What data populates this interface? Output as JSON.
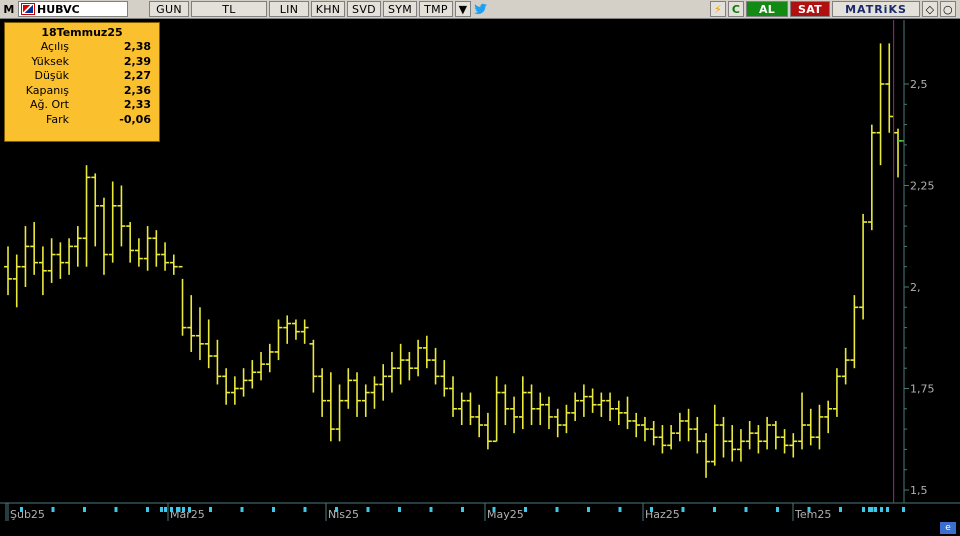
{
  "toolbar": {
    "menu_label": "M",
    "symbol": "HUBVC",
    "period": "GUN",
    "currency": "TL",
    "scale": "LIN",
    "b_khn": "KHN",
    "b_svd": "SVD",
    "b_sym": "SYM",
    "b_tmp": "TMP",
    "refresh": "C",
    "buy": "AL",
    "sell": "SAT",
    "brand": "MATRiKS"
  },
  "info": {
    "date": "18Temmuz25",
    "rows": [
      {
        "label": "Açılış",
        "value": "2,38"
      },
      {
        "label": "Yüksek",
        "value": "2,39"
      },
      {
        "label": "Düşük",
        "value": "2,27"
      },
      {
        "label": "Kapanış",
        "value": "2,36"
      },
      {
        "label": "Ağ. Ort",
        "value": "2,33"
      },
      {
        "label": "Fark",
        "value": "-0,06"
      }
    ]
  },
  "colors": {
    "background": "#000000",
    "bars": "#eaea3a",
    "axis": "#4a7a7a",
    "last_price_line": "#44bb44",
    "cursor_line": "#aa2288"
  },
  "chart_data": {
    "type": "ohlc",
    "y_ticks": [
      "2,5",
      "2,25",
      "2,",
      "1,75",
      "1,5"
    ],
    "y_tick_values": [
      2.5,
      2.25,
      2.0,
      1.75,
      1.5
    ],
    "ylim": [
      1.5,
      2.5
    ],
    "x_labels": [
      "Şub25",
      "Mar25",
      "Nis25",
      "May25",
      "Haz25",
      "Tem25"
    ],
    "last_close": 2.36,
    "bars": [
      [
        2.05,
        2.1,
        1.98,
        2.02
      ],
      [
        2.02,
        2.08,
        1.95,
        2.05
      ],
      [
        2.05,
        2.15,
        2.0,
        2.1
      ],
      [
        2.1,
        2.16,
        2.03,
        2.06
      ],
      [
        2.06,
        2.1,
        1.98,
        2.04
      ],
      [
        2.04,
        2.12,
        2.01,
        2.08
      ],
      [
        2.08,
        2.11,
        2.02,
        2.06
      ],
      [
        2.06,
        2.12,
        2.03,
        2.1
      ],
      [
        2.1,
        2.15,
        2.05,
        2.12
      ],
      [
        2.12,
        2.3,
        2.05,
        2.27
      ],
      [
        2.27,
        2.28,
        2.1,
        2.2
      ],
      [
        2.2,
        2.22,
        2.03,
        2.08
      ],
      [
        2.08,
        2.26,
        2.06,
        2.2
      ],
      [
        2.2,
        2.25,
        2.1,
        2.15
      ],
      [
        2.15,
        2.16,
        2.06,
        2.09
      ],
      [
        2.09,
        2.12,
        2.05,
        2.07
      ],
      [
        2.07,
        2.15,
        2.04,
        2.12
      ],
      [
        2.12,
        2.14,
        2.05,
        2.08
      ],
      [
        2.08,
        2.11,
        2.04,
        2.06
      ],
      [
        2.06,
        2.08,
        2.03,
        2.05
      ],
      [
        2.05,
        2.02,
        1.88,
        1.9
      ],
      [
        1.9,
        1.98,
        1.84,
        1.88
      ],
      [
        1.88,
        1.95,
        1.82,
        1.86
      ],
      [
        1.86,
        1.92,
        1.8,
        1.83
      ],
      [
        1.83,
        1.87,
        1.76,
        1.78
      ],
      [
        1.78,
        1.8,
        1.71,
        1.74
      ],
      [
        1.74,
        1.78,
        1.71,
        1.75
      ],
      [
        1.75,
        1.8,
        1.73,
        1.77
      ],
      [
        1.77,
        1.82,
        1.75,
        1.79
      ],
      [
        1.79,
        1.84,
        1.77,
        1.81
      ],
      [
        1.81,
        1.86,
        1.79,
        1.84
      ],
      [
        1.84,
        1.92,
        1.82,
        1.9
      ],
      [
        1.9,
        1.93,
        1.86,
        1.91
      ],
      [
        1.91,
        1.92,
        1.87,
        1.89
      ],
      [
        1.89,
        1.92,
        1.86,
        1.9
      ],
      [
        1.86,
        1.87,
        1.74,
        1.78
      ],
      [
        1.78,
        1.8,
        1.68,
        1.72
      ],
      [
        1.72,
        1.79,
        1.62,
        1.65
      ],
      [
        1.65,
        1.76,
        1.62,
        1.72
      ],
      [
        1.72,
        1.8,
        1.7,
        1.77
      ],
      [
        1.77,
        1.79,
        1.68,
        1.72
      ],
      [
        1.72,
        1.76,
        1.68,
        1.74
      ],
      [
        1.74,
        1.78,
        1.7,
        1.76
      ],
      [
        1.76,
        1.81,
        1.72,
        1.78
      ],
      [
        1.78,
        1.84,
        1.74,
        1.8
      ],
      [
        1.8,
        1.86,
        1.76,
        1.82
      ],
      [
        1.82,
        1.84,
        1.77,
        1.8
      ],
      [
        1.8,
        1.87,
        1.78,
        1.85
      ],
      [
        1.85,
        1.88,
        1.8,
        1.82
      ],
      [
        1.82,
        1.85,
        1.76,
        1.78
      ],
      [
        1.78,
        1.82,
        1.73,
        1.75
      ],
      [
        1.75,
        1.78,
        1.68,
        1.7
      ],
      [
        1.7,
        1.74,
        1.66,
        1.72
      ],
      [
        1.72,
        1.74,
        1.66,
        1.68
      ],
      [
        1.68,
        1.71,
        1.63,
        1.66
      ],
      [
        1.66,
        1.69,
        1.6,
        1.62
      ],
      [
        1.62,
        1.78,
        1.62,
        1.74
      ],
      [
        1.74,
        1.76,
        1.66,
        1.7
      ],
      [
        1.7,
        1.73,
        1.64,
        1.68
      ],
      [
        1.68,
        1.78,
        1.65,
        1.74
      ],
      [
        1.74,
        1.76,
        1.66,
        1.7
      ],
      [
        1.7,
        1.74,
        1.66,
        1.71
      ],
      [
        1.71,
        1.73,
        1.65,
        1.68
      ],
      [
        1.68,
        1.7,
        1.63,
        1.66
      ],
      [
        1.66,
        1.71,
        1.64,
        1.69
      ],
      [
        1.69,
        1.74,
        1.67,
        1.72
      ],
      [
        1.72,
        1.76,
        1.68,
        1.73
      ],
      [
        1.73,
        1.75,
        1.69,
        1.71
      ],
      [
        1.71,
        1.74,
        1.68,
        1.72
      ],
      [
        1.72,
        1.74,
        1.67,
        1.7
      ],
      [
        1.7,
        1.72,
        1.66,
        1.69
      ],
      [
        1.69,
        1.73,
        1.65,
        1.67
      ],
      [
        1.67,
        1.69,
        1.63,
        1.66
      ],
      [
        1.66,
        1.68,
        1.62,
        1.65
      ],
      [
        1.65,
        1.67,
        1.61,
        1.63
      ],
      [
        1.63,
        1.66,
        1.59,
        1.61
      ],
      [
        1.61,
        1.66,
        1.6,
        1.64
      ],
      [
        1.64,
        1.69,
        1.62,
        1.67
      ],
      [
        1.67,
        1.7,
        1.62,
        1.65
      ],
      [
        1.65,
        1.68,
        1.59,
        1.62
      ],
      [
        1.62,
        1.64,
        1.53,
        1.57
      ],
      [
        1.57,
        1.71,
        1.56,
        1.66
      ],
      [
        1.66,
        1.68,
        1.58,
        1.62
      ],
      [
        1.62,
        1.66,
        1.57,
        1.6
      ],
      [
        1.6,
        1.65,
        1.57,
        1.62
      ],
      [
        1.62,
        1.67,
        1.6,
        1.64
      ],
      [
        1.64,
        1.66,
        1.59,
        1.62
      ],
      [
        1.62,
        1.68,
        1.6,
        1.66
      ],
      [
        1.66,
        1.67,
        1.6,
        1.63
      ],
      [
        1.63,
        1.65,
        1.59,
        1.61
      ],
      [
        1.61,
        1.64,
        1.58,
        1.62
      ],
      [
        1.62,
        1.74,
        1.6,
        1.66
      ],
      [
        1.66,
        1.7,
        1.61,
        1.63
      ],
      [
        1.63,
        1.71,
        1.6,
        1.68
      ],
      [
        1.68,
        1.72,
        1.64,
        1.7
      ],
      [
        1.7,
        1.8,
        1.68,
        1.78
      ],
      [
        1.78,
        1.85,
        1.76,
        1.82
      ],
      [
        1.82,
        1.98,
        1.8,
        1.95
      ],
      [
        1.95,
        2.18,
        1.92,
        2.16
      ],
      [
        2.16,
        2.4,
        2.14,
        2.38
      ],
      [
        2.38,
        2.6,
        2.3,
        2.5
      ],
      [
        2.5,
        2.6,
        2.38,
        2.42
      ],
      [
        2.38,
        2.39,
        2.27,
        2.36
      ]
    ]
  }
}
